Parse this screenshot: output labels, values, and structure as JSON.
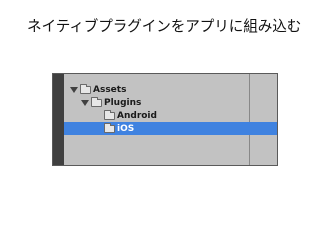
{
  "slide": {
    "title": "ネイティブプラグインをアプリに組み込む"
  },
  "project_tree": {
    "items": [
      {
        "label": "Assets",
        "expanded": true,
        "depth": 0
      },
      {
        "label": "Plugins",
        "expanded": true,
        "depth": 1
      },
      {
        "label": "Android",
        "expanded": false,
        "depth": 2
      },
      {
        "label": "iOS",
        "expanded": false,
        "depth": 2,
        "selected": true
      }
    ]
  },
  "colors": {
    "selection": "#3f82e0",
    "panel_background": "#c2c2c2",
    "left_bar": "#404040"
  },
  "icons": {
    "expand": "triangle-down-icon",
    "folder": "folder-icon"
  }
}
